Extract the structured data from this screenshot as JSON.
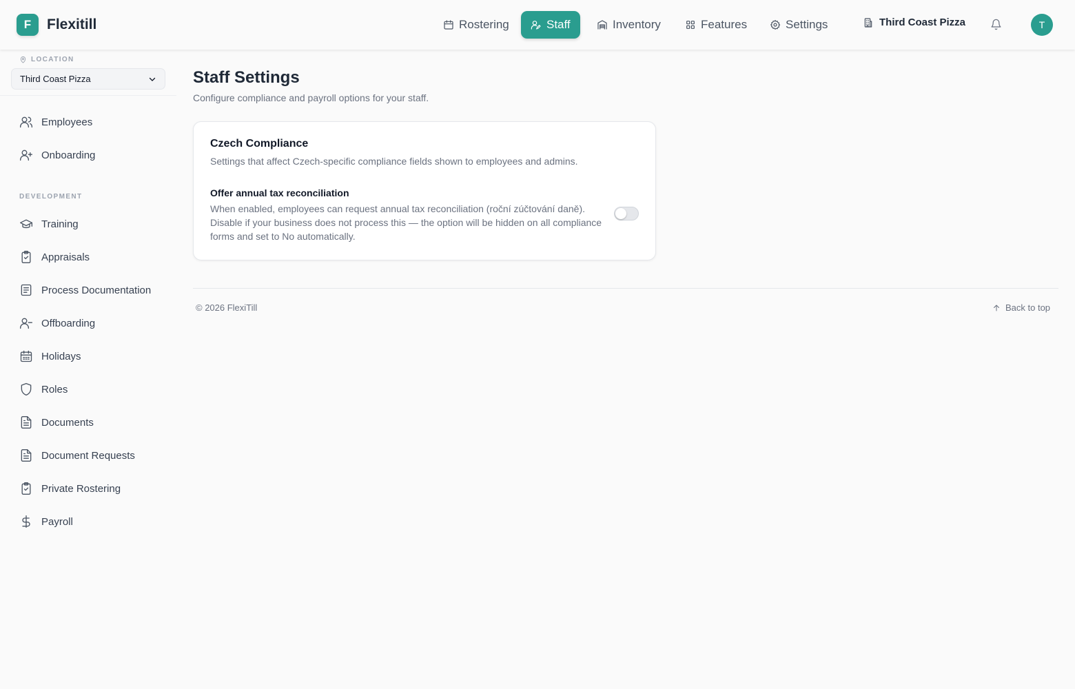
{
  "app": {
    "logo_letter": "F",
    "name": "Flexitill"
  },
  "nav": [
    {
      "label": "Rostering",
      "icon": "calendar-icon"
    },
    {
      "label": "Staff",
      "icon": "staff-icon",
      "active": true
    },
    {
      "label": "Inventory",
      "icon": "warehouse-icon"
    },
    {
      "label": "Features",
      "icon": "grid-icon"
    },
    {
      "label": "Settings",
      "icon": "gear-icon"
    }
  ],
  "header": {
    "org_name": "Third Coast Pizza",
    "avatar_initial": "T"
  },
  "sidebar": {
    "location_label": "LOCATION",
    "location_value": "Third Coast Pizza",
    "items_top": [
      {
        "label": "Employees",
        "icon": "users-icon"
      },
      {
        "label": "Onboarding",
        "icon": "user-plus-icon"
      }
    ],
    "section_label": "DEVELOPMENT",
    "items_dev": [
      {
        "label": "Training",
        "icon": "graduation-cap-icon"
      },
      {
        "label": "Appraisals",
        "icon": "clipboard-check-icon"
      },
      {
        "label": "Process Documentation",
        "icon": "book-icon"
      },
      {
        "label": "Offboarding",
        "icon": "user-minus-icon"
      },
      {
        "label": "Holidays",
        "icon": "calendar-days-icon"
      },
      {
        "label": "Roles",
        "icon": "shield-icon"
      },
      {
        "label": "Documents",
        "icon": "file-text-icon"
      },
      {
        "label": "Document Requests",
        "icon": "file-text-icon"
      },
      {
        "label": "Private Rostering",
        "icon": "clipboard-check-icon"
      },
      {
        "label": "Payroll",
        "icon": "dollar-icon"
      }
    ]
  },
  "main": {
    "title": "Staff Settings",
    "subtitle": "Configure compliance and payroll options for your staff.",
    "card": {
      "title": "Czech Compliance",
      "subtitle": "Settings that affect Czech-specific compliance fields shown to employees and admins.",
      "option_title": "Offer annual tax reconciliation",
      "option_desc": "When enabled, employees can request annual tax reconciliation (roční zúčtování daně). Disable if your business does not process this — the option will be hidden on all compliance forms and set to No automatically.",
      "toggle_on": false
    }
  },
  "footer": {
    "copyright": "© 2026 FlexiTill",
    "back_to_top": "Back to top"
  },
  "colors": {
    "accent": "#2a9d8f",
    "background": "#fafafa"
  }
}
